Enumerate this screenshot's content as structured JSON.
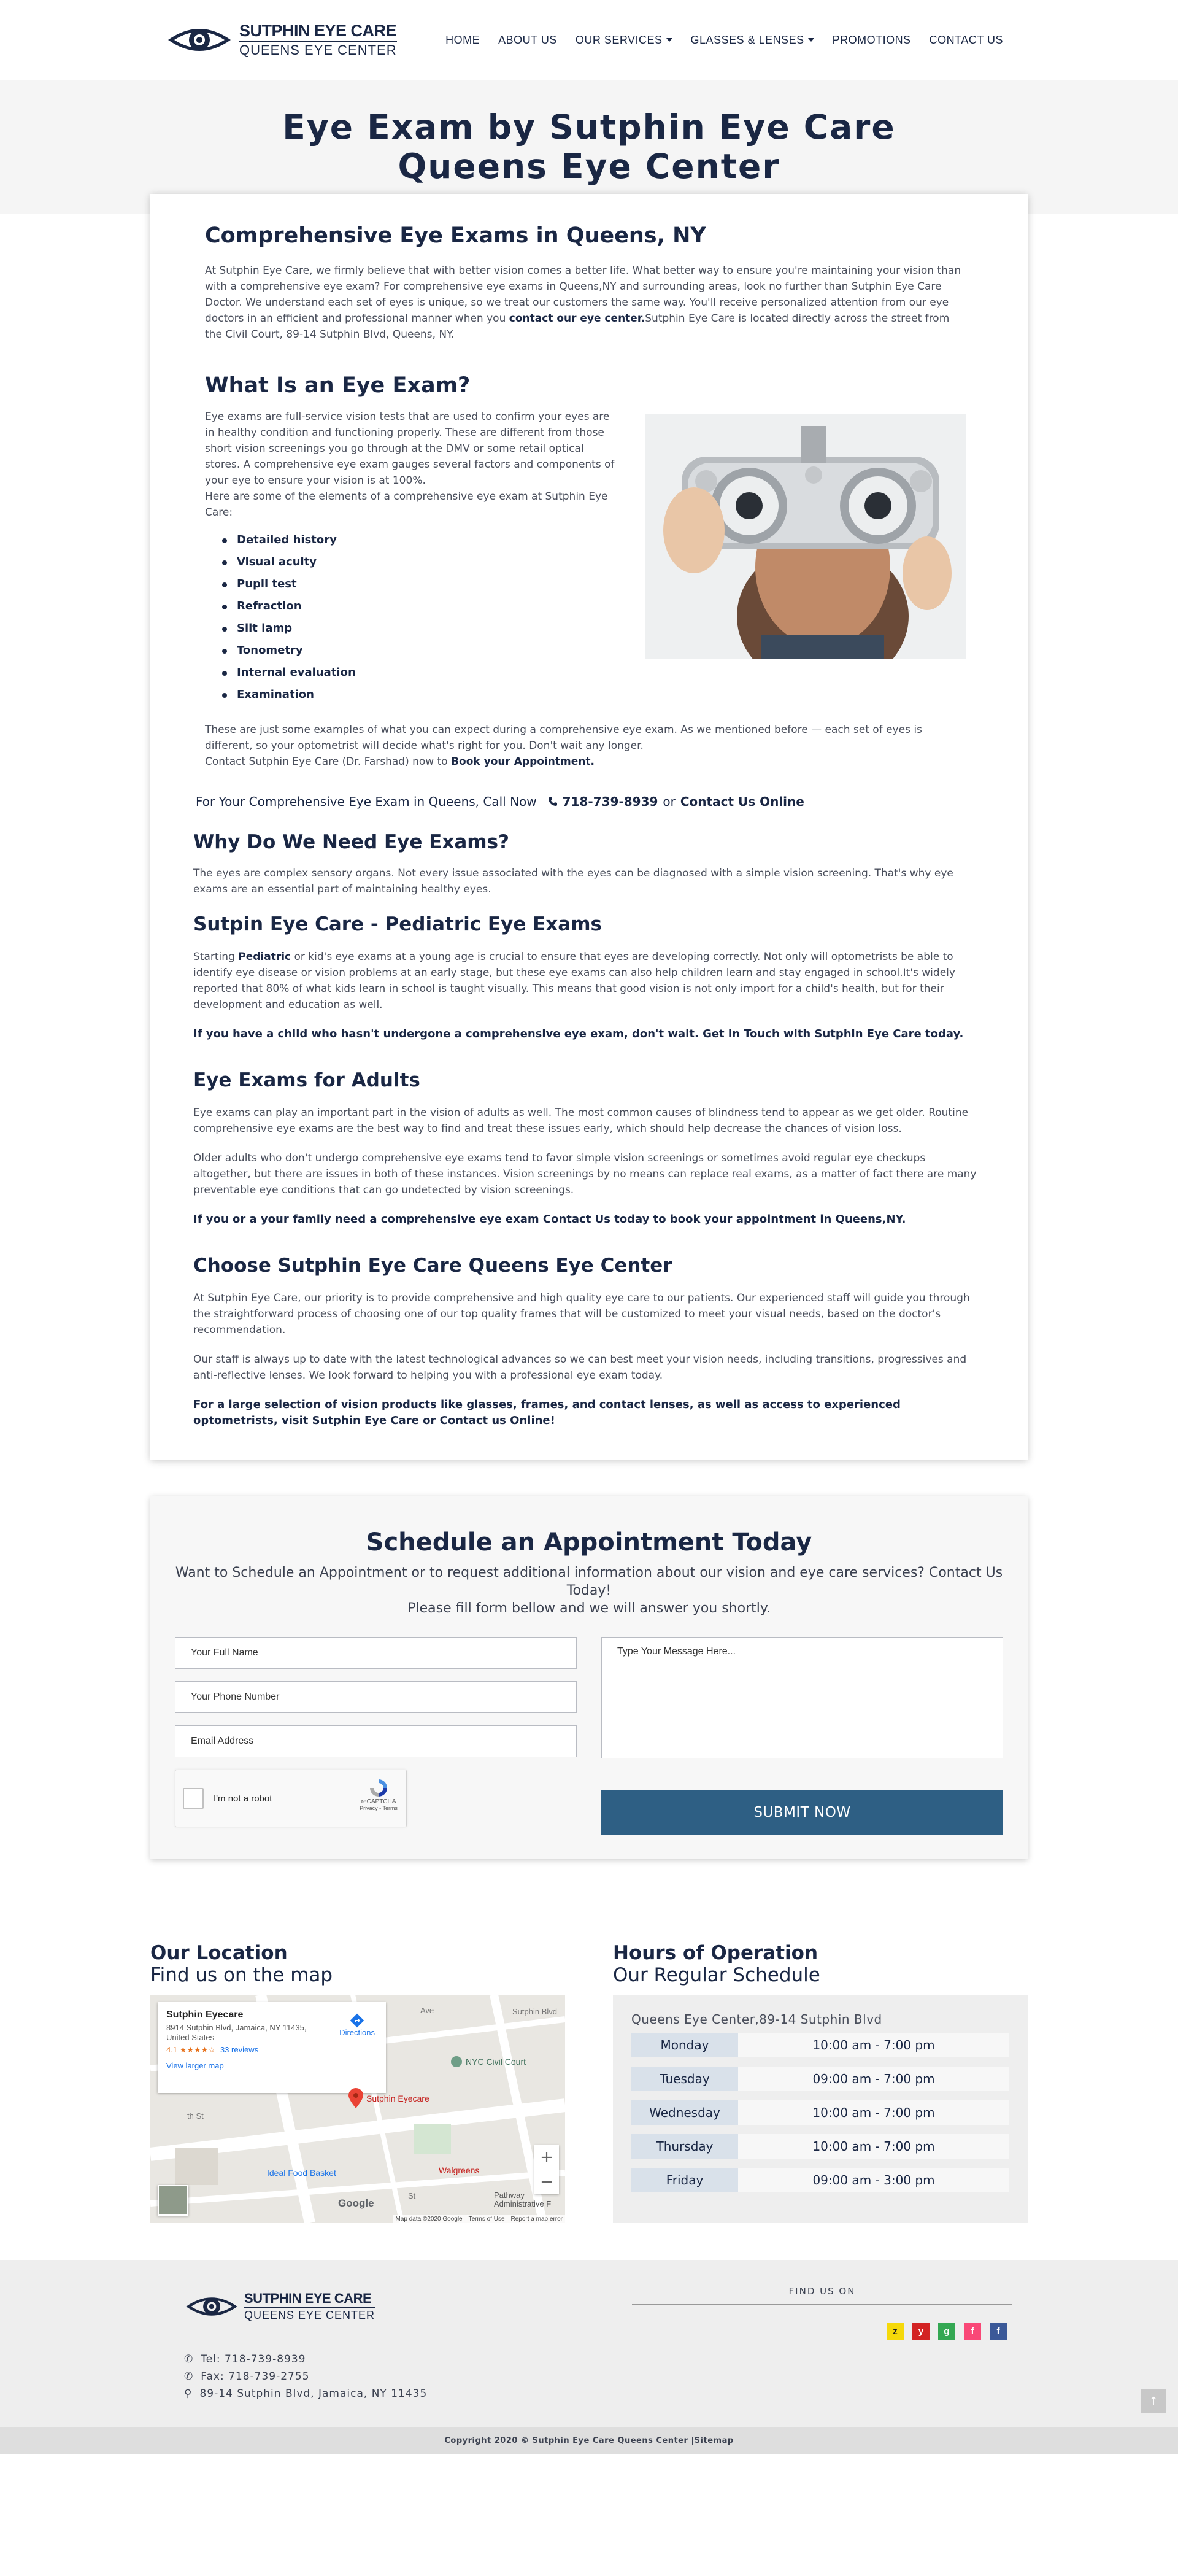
{
  "header": {
    "logo_line1": "SUTPHIN EYE CARE",
    "logo_line2": "QUEENS EYE CENTER",
    "nav": [
      {
        "label": "HOME"
      },
      {
        "label": "ABOUT US"
      },
      {
        "label": "OUR SERVICES"
      },
      {
        "label": "GLASSES & LENSES"
      },
      {
        "label": "PROMOTIONS"
      },
      {
        "label": "CONTACT US"
      }
    ]
  },
  "banner": {
    "title_line1": "Eye Exam by Sutphin Eye Care",
    "title_line2": "Queens Eye Center"
  },
  "intro": {
    "title": "Comprehensive Eye Exams in Queens, NY",
    "text_a": "At Sutphin Eye Care, we firmly believe that with better vision comes a better life. What better way to ensure you're maintaining your vision than with a comprehensive eye exam? For comprehensive eye exams in Queens,NY and surrounding areas, look no further than Sutphin Eye Care Doctor. We understand each set of eyes is unique, so we treat our customers the same way. You'll receive personalized attention from our eye doctors in an efficient and professional manner when you ",
    "link": "contact our eye center.",
    "text_b": "Sutphin Eye Care is located directly across the street from the Civil Court, 89-14 Sutphin Blvd, Queens, NY."
  },
  "what_is": {
    "title": "What Is an Eye Exam?",
    "text": "Eye exams are full-service vision tests that are used to confirm your eyes are in healthy condition and functioning properly. These are different from those short vision screenings you go through at the DMV or some retail optical stores. A comprehensive eye exam gauges several factors and components of your eye to ensure your vision is at 100%.",
    "text2": "Here are some of the elements of a comprehensive eye exam at Sutphin Eye Care:",
    "items": [
      "Detailed history",
      "Visual acuity",
      "Pupil test",
      "Refraction",
      "Slit lamp",
      "Tonometry",
      "Internal evaluation",
      "Examination"
    ],
    "after": "These are just some examples of what you can expect during a comprehensive eye exam. As we mentioned before — each set of eyes is different, so your optometrist will decide what's right for you. Don't wait any longer.",
    "contact_a": "Contact Sutphin Eye Care (Dr. Farshad) now to ",
    "contact_link": "Book your Appointment."
  },
  "call": {
    "text": "For Your Comprehensive Eye Exam in Queens, Call Now",
    "phone": "718-739-8939",
    "or": "or",
    "link": "Contact Us Online"
  },
  "why": {
    "title": "Why Do We Need Eye Exams?",
    "text": "The eyes are complex sensory organs. Not every issue associated with the eyes can be diagnosed with a simple vision screening. That's why eye exams are an essential part of maintaining healthy eyes."
  },
  "pediatric": {
    "title": "Sutpin Eye Care - Pediatric Eye Exams",
    "text_a": "Starting ",
    "bold": "Pediatric",
    "text_b": " or kid's eye exams at a young age is crucial to ensure that eyes are developing correctly. Not only will optometrists be able to identify eye disease or vision problems at an early stage, but these eye exams can also help children learn and stay engaged in school.It's widely reported that 80% of what kids learn in school is taught visually. This means that good vision is not only import for a child's health, but for their development and education as well.",
    "cta": "If you have a child who hasn't undergone a comprehensive eye exam, don't wait. Get in Touch with Sutphin Eye Care today."
  },
  "adults": {
    "title": "Eye Exams for Adults",
    "text1": "Eye exams can play an important part in the vision of adults as well. The most common causes of blindness tend to appear as we get older. Routine comprehensive eye exams are the best way to find and treat these issues early, which should help decrease the chances of vision loss.",
    "text2": "Older adults who don't undergo comprehensive eye exams tend to favor simple vision screenings or sometimes avoid regular eye checkups altogether, but there are issues in both of these instances. Vision screenings by no means can replace real exams, as a matter of fact there are many preventable eye conditions that can go undetected by vision screenings.",
    "cta": "If you or a your family need a comprehensive eye exam Contact Us today to book your appointment in Queens,NY."
  },
  "choose": {
    "title": "Choose Sutphin Eye Care Queens Eye Center",
    "text1": "At Sutphin Eye Care, our priority is to provide comprehensive and high quality eye care to our patients. Our experienced staff will guide you through the straightforward process of choosing one of our top quality frames that will be customized to meet your visual needs, based on the doctor's recommendation.",
    "text2": "Our staff is always up to date with the latest technological advances so we can best meet your vision needs, including transitions, progressives and anti-reflective lenses. We look forward to helping you with a professional eye exam today.",
    "cta": "For a large selection of vision products like glasses, frames, and contact lenses, as well as access to experienced optometrists, visit Sutphin Eye Care or Contact us Online!"
  },
  "appointment": {
    "title": "Schedule an Appointment Today",
    "sub1": "Want to Schedule an Appointment or to request additional information about our vision and eye care services? Contact Us Today!",
    "sub2": "Please fill form bellow and we will answer you shortly.",
    "name_ph": "Your Full Name",
    "phone_ph": "Your Phone Number",
    "email_ph": "Email Address",
    "message_ph": "Type Your Message Here...",
    "captcha_label": "I'm not a robot",
    "captcha_brand": "reCAPTCHA",
    "captcha_links": "Privacy - Terms",
    "submit": "SUBMIT NOW"
  },
  "location": {
    "title": "Our Location",
    "subtitle": "Find us on the map",
    "map_name": "Sutphin Eyecare",
    "map_address": "8914 Sutphin Blvd, Jamaica, NY 11435, United States",
    "map_rating": "4.1 ★★★★☆",
    "map_reviews": "33 reviews",
    "map_larger": "View larger map",
    "map_directions": "Directions",
    "map_labels": {
      "civil": "NYC Civil Court",
      "pin": "Sutphin Eyecare",
      "ideal": "Ideal Food Basket",
      "walgreens": "Walgreens",
      "pathway": "Pathway",
      "admin": "Administrative F",
      "ave": "Ave",
      "st": "th St",
      "st2": "St",
      "sutphin": "Sutphin Blvd",
      "google": "Google",
      "attrib": "Map data ©2020 Google",
      "terms": "Terms of Use",
      "report": "Report a map error"
    }
  },
  "hours": {
    "title": "Hours of Operation",
    "subtitle": "Our Regular Schedule",
    "location": "Queens Eye Center,89-14 Sutphin Blvd",
    "rows": [
      {
        "day": "Monday",
        "time": "10:00 am - 7:00 pm"
      },
      {
        "day": "Tuesday",
        "time": "09:00 am - 7:00 pm"
      },
      {
        "day": "Wednesday",
        "time": "10:00 am - 7:00 pm"
      },
      {
        "day": "Thursday",
        "time": "10:00 am - 7:00 pm"
      },
      {
        "day": "Friday",
        "time": "09:00 am - 3:00 pm"
      }
    ]
  },
  "footer": {
    "tel": "Tel: 718-739-8939",
    "fax": "Fax: 718-739-2755",
    "address": "89-14 Sutphin Blvd, Jamaica, NY 11435",
    "find_us": "FIND US ON",
    "copyright": "Copyright 2020 © Sutphin Eye Care Queens Center |Sitemap"
  },
  "colors": {
    "navy": "#1a2744",
    "submit": "#2e5f84",
    "banner_bg": "#f5f5f5",
    "day_bg": "#d9e1ea"
  }
}
